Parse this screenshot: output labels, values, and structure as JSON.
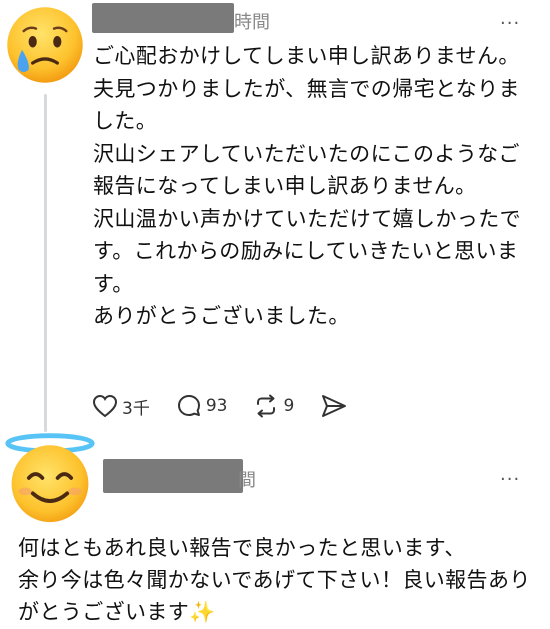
{
  "post1": {
    "avatar_icon": "crying-face-emoji",
    "time_suffix": "時間",
    "more_label": "...",
    "text": "ご心配おかけしてしまい申し訳ありません。\n夫見つかりましたが、無言での帰宅となりました。\n沢山シェアしていただいたのにこのようなご報告になってしまい申し訳ありません。\n沢山温かい声かけていただけて嬉しかったです。これからの励みにしていきたいと思います。\nありがとうございました。",
    "likes": "3千",
    "replies": "93",
    "reposts": "9"
  },
  "post2": {
    "avatar_icon": "smiling-face-with-halo-emoji",
    "time_suffix": "間",
    "more_label": "...",
    "text": "何はともあれ良い報告で良かったと思います、\n余り今は色々聞かないであげて下さい！良い報告ありがとうございます✨"
  },
  "colors": {
    "name_redaction": "#7a7a7a",
    "thread_line": "#d6dadd",
    "sparkle": "#f5b800"
  }
}
